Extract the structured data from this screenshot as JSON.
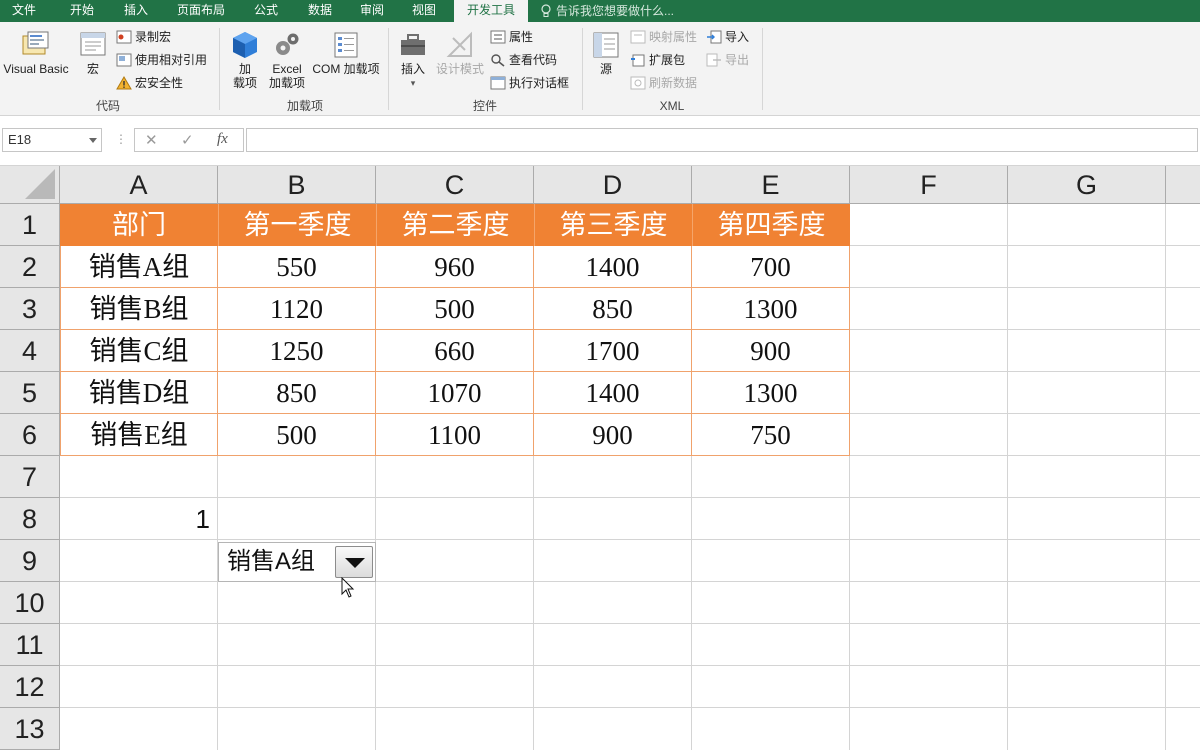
{
  "menu": {
    "tabs": [
      "文件",
      "开始",
      "插入",
      "页面布局",
      "公式",
      "数据",
      "审阅",
      "视图",
      "开发工具"
    ],
    "active_tab": "开发工具",
    "tell_me": "告诉我您想要做什么..."
  },
  "ribbon": {
    "code_group": {
      "label": "代码",
      "visual_basic": "Visual Basic",
      "macros": "宏",
      "record_macro": "录制宏",
      "use_relative": "使用相对引用",
      "macro_security": "宏安全性"
    },
    "addins_group": {
      "label": "加载项",
      "addins_line1": "加",
      "addins_line2": "载项",
      "excel_addins_line1": "Excel",
      "excel_addins_line2": "加载项",
      "com_addins": "COM 加载项"
    },
    "controls_group": {
      "label": "控件",
      "insert": "插入",
      "design_mode": "设计模式",
      "properties": "属性",
      "view_code": "查看代码",
      "run_dialog": "执行对话框"
    },
    "xml_group": {
      "label": "XML",
      "source": "源",
      "map_properties": "映射属性",
      "expansion_packs": "扩展包",
      "refresh_data": "刷新数据",
      "import": "导入",
      "export": "导出"
    }
  },
  "formula_bar": {
    "name_box": "E18",
    "cancel_icon": "✕",
    "enter_icon": "✓",
    "fx_label": "fx",
    "formula": ""
  },
  "sheet": {
    "columns": [
      "A",
      "B",
      "C",
      "D",
      "E",
      "F",
      "G"
    ],
    "rows": [
      "1",
      "2",
      "3",
      "4",
      "5",
      "6",
      "7",
      "8",
      "9",
      "10",
      "11",
      "12",
      "13"
    ],
    "header": [
      "部门",
      "第一季度",
      "第二季度",
      "第三季度",
      "第四季度"
    ],
    "data": [
      [
        "销售A组",
        "550",
        "960",
        "1400",
        "700"
      ],
      [
        "销售B组",
        "1120",
        "500",
        "850",
        "1300"
      ],
      [
        "销售C组",
        "1250",
        "660",
        "1700",
        "900"
      ],
      [
        "销售D组",
        "850",
        "1070",
        "1400",
        "1300"
      ],
      [
        "销售E组",
        "500",
        "1100",
        "900",
        "750"
      ]
    ],
    "a8_value": "1"
  },
  "combo_box": {
    "selected": "销售A组"
  },
  "colors": {
    "excel_green": "#217346",
    "header_fill": "#f08233",
    "table_border": "#f0a26c"
  }
}
